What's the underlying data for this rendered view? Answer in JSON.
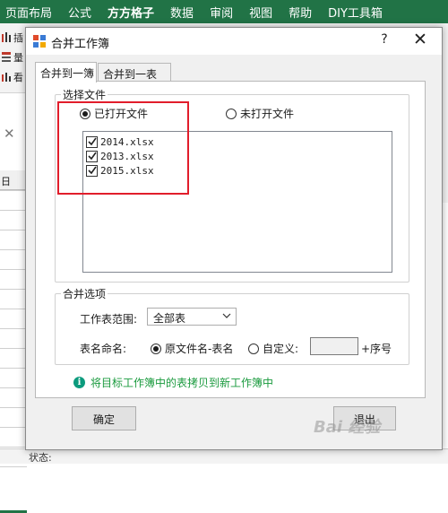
{
  "excel": {
    "ribbon_tabs": [
      "页面布局",
      "公式",
      "方方格子",
      "数据",
      "审阅",
      "视图",
      "帮助",
      "DIY工具箱"
    ],
    "active_tab": "方方格子",
    "left_glyphs": [
      "插",
      "量",
      "看"
    ],
    "col_header": "日",
    "status_label": "状态:",
    "accent_color": "#217346"
  },
  "dialog": {
    "title": "合并工作簿",
    "help_label": "?",
    "close_label": "✕",
    "tabs": [
      "合并到一簿",
      "合并到一表"
    ],
    "select_files": {
      "group_label": "选择文件",
      "radio_opened": "已打开文件",
      "radio_unopened": "未打开文件",
      "selected_radio": "已打开文件",
      "files": [
        {
          "name": "2014.xlsx",
          "checked": true
        },
        {
          "name": "2013.xlsx",
          "checked": true
        },
        {
          "name": "2015.xlsx",
          "checked": true
        }
      ]
    },
    "merge_options": {
      "group_label": "合并选项",
      "range_label": "工作表范围:",
      "range_value": "全部表",
      "naming_label": "表名命名:",
      "radio_original": "原文件名-表名",
      "radio_custom": "自定义:",
      "custom_value": "",
      "suffix_label": "+序号",
      "selected_naming": "原文件名-表名"
    },
    "info": {
      "icon": "info-icon",
      "text": "将目标工作簿中的表拷贝到新工作簿中"
    },
    "buttons": {
      "ok": "确定",
      "exit": "退出"
    }
  },
  "watermark": "Bai 经验",
  "highlight_color": "#e11d2b"
}
